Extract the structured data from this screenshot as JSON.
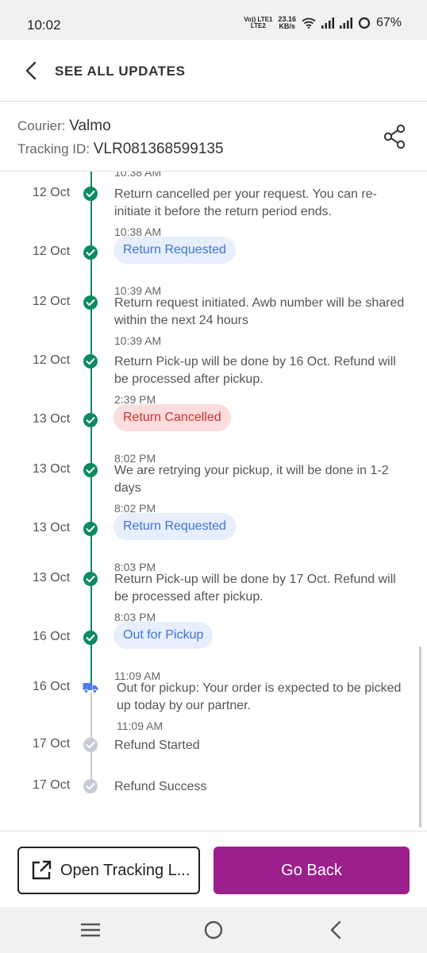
{
  "status_bar": {
    "time": "10:02",
    "volte_top": "Vo)) LTE1",
    "volte_bottom": "LTE2",
    "net_speed_value": "23.16",
    "net_speed_unit": "KB/s",
    "battery_percent": "67%"
  },
  "header": {
    "title": "SEE ALL UPDATES"
  },
  "courier": {
    "courier_label": "Courier:",
    "courier_name": "Valmo",
    "tracking_label": "Tracking ID:",
    "tracking_id": "VLR081368599135"
  },
  "timeline": {
    "cut_off_time": "10:38 AM",
    "items": [
      {
        "date": "12 Oct",
        "type": "text",
        "text": "Return cancelled per your request. You can re-initiate it before the return period ends.",
        "time": "10:38 AM",
        "status": "done"
      },
      {
        "date": "12 Oct",
        "type": "pill",
        "text": "Return Requested",
        "time": "10:39 AM",
        "status": "done"
      },
      {
        "date": "12 Oct",
        "type": "text",
        "text": "Return request initiated. Awb number will be shared within the next 24 hours",
        "time": "10:39 AM",
        "status": "done"
      },
      {
        "date": "12 Oct",
        "type": "text",
        "text": "Return Pick-up will be done by 16 Oct. Refund will be processed after pickup.",
        "time": "2:39 PM",
        "status": "done"
      },
      {
        "date": "13 Oct",
        "type": "pill-red",
        "text": "Return Cancelled",
        "time": "8:02 PM",
        "status": "done"
      },
      {
        "date": "13 Oct",
        "type": "text",
        "text": "We are retrying your pickup, it will be done in 1-2 days",
        "time": "8:02 PM",
        "status": "done"
      },
      {
        "date": "13 Oct",
        "type": "pill",
        "text": "Return Requested",
        "time": "8:03 PM",
        "status": "done"
      },
      {
        "date": "13 Oct",
        "type": "text",
        "text": "Return Pick-up will be done by 17 Oct. Refund will be processed after pickup.",
        "time": "8:03 PM",
        "status": "done"
      },
      {
        "date": "16 Oct",
        "type": "pill",
        "text": "Out for Pickup",
        "time": "11:09 AM",
        "status": "done"
      },
      {
        "date": "16 Oct",
        "type": "text",
        "text": "Out for pickup: Your order is expected to be picked up today by our partner.",
        "time": "11:09 AM",
        "status": "current"
      },
      {
        "date": "17 Oct",
        "type": "text",
        "text": "Refund Started",
        "time": "",
        "status": "pending"
      },
      {
        "date": "17 Oct",
        "type": "text",
        "text": "Refund Success",
        "time": "",
        "status": "pending"
      }
    ]
  },
  "footer": {
    "open_tracking_label": "Open Tracking L...",
    "go_back_label": "Go Back"
  },
  "colors": {
    "done": "#0e8a5f",
    "pending": "#c9cbd6",
    "truck": "#4f7ee8",
    "primary_button": "#9b1f8c",
    "pill_blue_bg": "#e7eefc",
    "pill_blue_text": "#3e74d6",
    "pill_red_bg": "#fcdcdc",
    "pill_red_text": "#d42e2e"
  }
}
